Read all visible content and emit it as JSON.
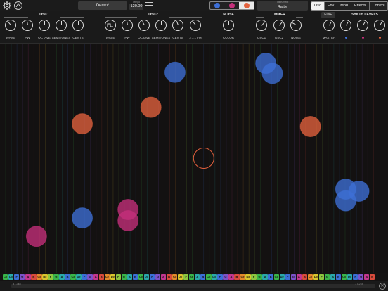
{
  "topbar": {
    "preset_name": "Demo*",
    "tempo_label": "Tempo",
    "tempo_value": "120.00",
    "instrument_label": "Instrument",
    "instrument_value": "Rattle",
    "colors": [
      "#3d6fd6",
      "#c5307b",
      "#e2613d"
    ],
    "active_color_index": 2,
    "tabs": [
      {
        "label": "Osc",
        "active": true
      },
      {
        "label": "Env",
        "active": false
      },
      {
        "label": "Mod",
        "active": false
      },
      {
        "label": "Effects",
        "active": false
      },
      {
        "label": "Control",
        "active": false
      }
    ]
  },
  "synth": {
    "osc1": {
      "title": "OSC1",
      "labels": [
        "WAVE",
        "PW",
        "OCTAVE",
        "SEMITONES",
        "CENTS"
      ]
    },
    "osc2": {
      "title": "OSC2",
      "labels": [
        "WAVE",
        "PW",
        "OCTAVE",
        "SEMITONES",
        "CENTS",
        "2→1 FM"
      ]
    },
    "noise": {
      "title": "NOISE",
      "labels": [
        "COLOR"
      ]
    },
    "mixer": {
      "title": "MIXER",
      "labels": [
        "OSC1",
        "OSC2",
        "NOISE"
      ]
    },
    "levels": {
      "title": "SYNTH LEVELS",
      "fine": "FINE",
      "labels": [
        "MASTER"
      ]
    }
  },
  "notes": [
    {
      "color": "#3d6fd6",
      "col": 0.451,
      "row": 0.122,
      "filled": true
    },
    {
      "color": "#3d6fd6",
      "col": 0.685,
      "row": 0.083,
      "filled": true
    },
    {
      "color": "#3d6fd6",
      "col": 0.702,
      "row": 0.127,
      "filled": true
    },
    {
      "color": "#e2613d",
      "col": 0.389,
      "row": 0.275,
      "filled": true
    },
    {
      "color": "#e2613d",
      "col": 0.212,
      "row": 0.347,
      "filled": true
    },
    {
      "color": "#e2613d",
      "col": 0.8,
      "row": 0.359,
      "filled": true
    },
    {
      "color": "#e2613d",
      "col": 0.525,
      "row": 0.497,
      "filled": false
    },
    {
      "color": "#3d6fd6",
      "col": 0.891,
      "row": 0.632,
      "filled": true
    },
    {
      "color": "#3d6fd6",
      "col": 0.925,
      "row": 0.641,
      "filled": true
    },
    {
      "color": "#3d6fd6",
      "col": 0.891,
      "row": 0.683,
      "filled": true
    },
    {
      "color": "#c5307b",
      "col": 0.33,
      "row": 0.721,
      "filled": true
    },
    {
      "color": "#c5307b",
      "col": 0.33,
      "row": 0.77,
      "filled": true
    },
    {
      "color": "#3d6fd6",
      "col": 0.212,
      "row": 0.758,
      "filled": true
    },
    {
      "color": "#c5307b",
      "col": 0.094,
      "row": 0.838,
      "filled": true
    }
  ],
  "keyboard": {
    "pattern": [
      "C#",
      "D#",
      "F",
      "G",
      "A",
      "B",
      "C#",
      "D#",
      "F",
      "G",
      "A",
      "B"
    ],
    "colors": [
      "#39b54a",
      "#2aa9a9",
      "#3b6fd6",
      "#7b52c9",
      "#c2378f",
      "#d94b3c",
      "#e48a2a",
      "#d9c52d",
      "#8cc63f",
      "#39b54a",
      "#2aa9a9",
      "#3b6fd6"
    ]
  },
  "bottombar": {
    "left_label": "37.3kx",
    "right_label": "17.2kx"
  }
}
